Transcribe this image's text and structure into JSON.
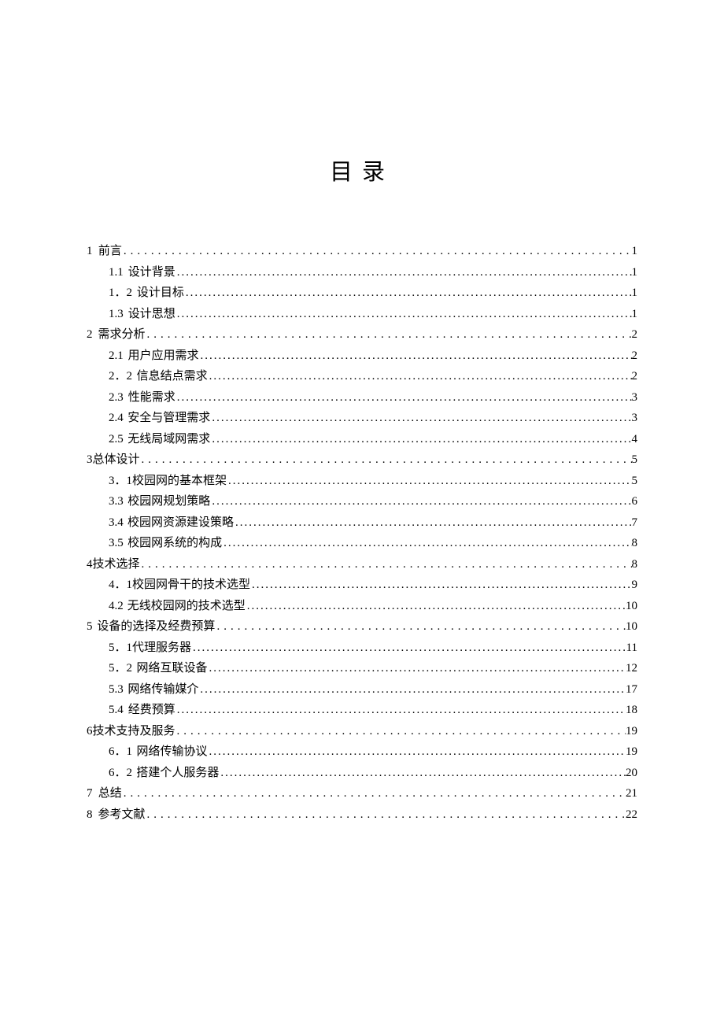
{
  "title": "目录",
  "entries": [
    {
      "level": 1,
      "num": "1",
      "gap": "wide",
      "label": "前言",
      "page": "1",
      "dots": "sparse"
    },
    {
      "level": 2,
      "num": "1.1",
      "subgap": true,
      "label": "设计背景",
      "page": "1",
      "dots": "dense"
    },
    {
      "level": 2,
      "num": "1．2",
      "subgap": true,
      "label": "设计目标",
      "page": "1",
      "dots": "dense"
    },
    {
      "level": 2,
      "num": "1.3",
      "subgap": true,
      "label": "设计思想",
      "page": "1",
      "dots": "dense"
    },
    {
      "level": 1,
      "num": "2",
      "gap": "wide",
      "label": "需求分析",
      "page": "2",
      "dots": "sparse"
    },
    {
      "level": 2,
      "num": "2.1",
      "subgap": true,
      "label": "用户应用需求",
      "page": "2",
      "dots": "dense"
    },
    {
      "level": 2,
      "num": "2．2",
      "subgap": true,
      "label": "信息结点需求",
      "page": "2",
      "dots": "dense"
    },
    {
      "level": 2,
      "num": "2.3",
      "subgap": true,
      "label": "性能需求",
      "page": "3",
      "dots": "dense"
    },
    {
      "level": 2,
      "num": "2.4",
      "subgap": true,
      "label": "安全与管理需求",
      "page": "3",
      "dots": "dense"
    },
    {
      "level": 2,
      "num": "2.5",
      "subgap": true,
      "label": "无线局域网需求",
      "page": "4",
      "dots": "dense"
    },
    {
      "level": 1,
      "num": "3",
      "gap": "narrow",
      "label": "总体设计",
      "page": "5",
      "dots": "sparse"
    },
    {
      "level": 2,
      "num": "3．1",
      "subgap": false,
      "label": "校园网的基本框架",
      "page": "5",
      "dots": "dense"
    },
    {
      "level": 2,
      "num": "3.3",
      "subgap": true,
      "label": "校园网规划策略",
      "page": "6",
      "dots": "dense"
    },
    {
      "level": 2,
      "num": "3.4",
      "subgap": true,
      "label": "校园网资源建设策略",
      "page": "7",
      "dots": "dense"
    },
    {
      "level": 2,
      "num": "3.5",
      "subgap": true,
      "label": "校园网系统的构成",
      "page": "8",
      "dots": "dense"
    },
    {
      "level": 1,
      "num": "4",
      "gap": "narrow",
      "label": "技术选择",
      "page": "8",
      "dots": "sparse"
    },
    {
      "level": 2,
      "num": "4．1",
      "subgap": false,
      "label": "校园网骨干的技术选型",
      "page": "9",
      "dots": "dense"
    },
    {
      "level": 2,
      "num": "4.2",
      "subgap": true,
      "label": "无线校园网的技术选型",
      "page": "10",
      "dots": "dense"
    },
    {
      "level": 1,
      "num": "5",
      "gap": "wide",
      "label": "设备的选择及经费预算",
      "page": "10",
      "dots": "sparse"
    },
    {
      "level": 2,
      "num": "5．1",
      "subgap": false,
      "label": "代理服务器",
      "page": "11",
      "dots": "dense"
    },
    {
      "level": 2,
      "num": "5．2",
      "subgap": true,
      "label": "网络互联设备",
      "page": "12",
      "dots": "dense"
    },
    {
      "level": 2,
      "num": "5.3",
      "subgap": true,
      "label": "网络传输媒介",
      "page": "17",
      "dots": "dense"
    },
    {
      "level": 2,
      "num": "5.4",
      "subgap": true,
      "label": "经费预算",
      "page": "18",
      "dots": "dense"
    },
    {
      "level": 1,
      "num": "6",
      "gap": "narrow",
      "label": "技术支持及服务",
      "page": "19",
      "dots": "sparse"
    },
    {
      "level": 2,
      "num": "6．1",
      "subgap": true,
      "label": "网络传输协议",
      "page": "19",
      "dots": "dense"
    },
    {
      "level": 2,
      "num": "6．2",
      "subgap": true,
      "label": "搭建个人服务器",
      "page": "20",
      "dots": "dense"
    },
    {
      "level": 1,
      "num": "7",
      "gap": "wide",
      "label": "总结",
      "page": "21",
      "dots": "sparse"
    },
    {
      "level": 1,
      "num": "8",
      "gap": "wide",
      "label": "参考文献",
      "page": "22",
      "dots": "sparse"
    }
  ]
}
